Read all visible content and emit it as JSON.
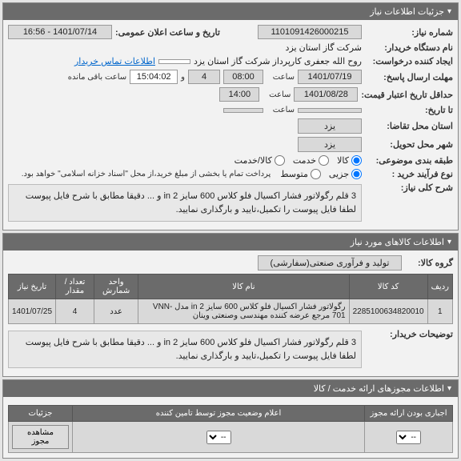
{
  "panel_info": {
    "title": "جزئیات اطلاعات نیاز",
    "need_number_label": "شماره نیاز:",
    "need_number": "1101091426000215",
    "announce_date_label": "تاریخ و ساعت اعلان عمومی:",
    "announce_date": "1401/07/14 - 16:56",
    "buyer_org_label": "نام دستگاه خریدار:",
    "buyer_org": "شرکت گاز استان یزد",
    "requester_label": "ایجاد کننده درخواست:",
    "requester": "روح الله جعفری کارپرداز شرکت گاز استان یزد",
    "contact_link": "اطلاعات تماس خریدار",
    "response_deadline_label": "مهلت ارسال پاسخ:",
    "response_date": "1401/07/19",
    "time_label": "ساعت",
    "response_time": "08:00",
    "days_count": "4",
    "remaining_time": "15:04:02",
    "remaining_label": "ساعت باقی مانده",
    "min_validity_label": "حداقل تاریخ اعتبار قیمت:",
    "validity_date": "1401/08/28",
    "validity_time": "14:00",
    "delivery_date_label": "تا تاریخ:",
    "request_city_label": "استان محل تقاضا:",
    "city_yazd": "یزد",
    "delivery_city_label": "شهر محل تحویل:",
    "subject_type_label": "طبقه بندی موضوعی:",
    "radio_goods": "کالا",
    "radio_service": "خدمت",
    "radio_both": "کالا/خدمت",
    "purchase_type_label": "نوع فرآیند خرید :",
    "radio_partial": "جزیی",
    "radio_medium": "متوسط",
    "purchase_note": "پرداخت تمام یا بخشی از مبلغ خرید،از محل \"اسناد خزانه اسلامی\" خواهد بود.",
    "summary_label": "شرح کلی نیاز:",
    "summary_text": "3 قلم رگولاتور فشار اکسیال فلو کلاس 600 سایز in 2 و ... دقیقا مطابق با شرح فایل پیوست لطفا فایل پیوست را تکمیل،تایید و بارگذاری نمایید."
  },
  "panel_goods": {
    "title": "اطلاعات کالاهای مورد نیاز",
    "group_label": "گروه کالا:",
    "group_value": "تولید و فرآوری صنعتی(سفارشی)",
    "columns": {
      "row": "ردیف",
      "code": "کد کالا",
      "name": "نام کالا",
      "unit": "واحد شمارش",
      "qty": "تعداد / مقدار",
      "date": "تاریخ نیاز"
    },
    "rows": [
      {
        "idx": "1",
        "code": "2285100634820010",
        "name": "رگولاتور فشار اکسیال فلو کلاس 600 سایز in 2 مدل -VNN 701 مرجع عرضه کننده مهندسی وصنعتی وینان",
        "unit": "عدد",
        "qty": "4",
        "date": "1401/07/25"
      }
    ],
    "buyer_notes_label": "توضیحات خریدار:",
    "buyer_notes": "3 قلم رگولاتور فشار اکسیال فلو کلاس 600 سایز in 2 و ... دقیقا مطابق با شرح فایل پیوست لطفا فایل پیوست را تکمیل،تایید و بارگذاری نمایید."
  },
  "panel_permits": {
    "title": "اطلاعات مجوزهای ارائه خدمت / کالا",
    "columns": {
      "mandatory": "اجباری بودن ارائه مجوز",
      "title_col": "اعلام وضعیت مجوز توسط تامین کننده",
      "details": "جزئیات"
    },
    "row": {
      "select_placeholder": "--",
      "view_btn": "مشاهده مجوز"
    }
  }
}
